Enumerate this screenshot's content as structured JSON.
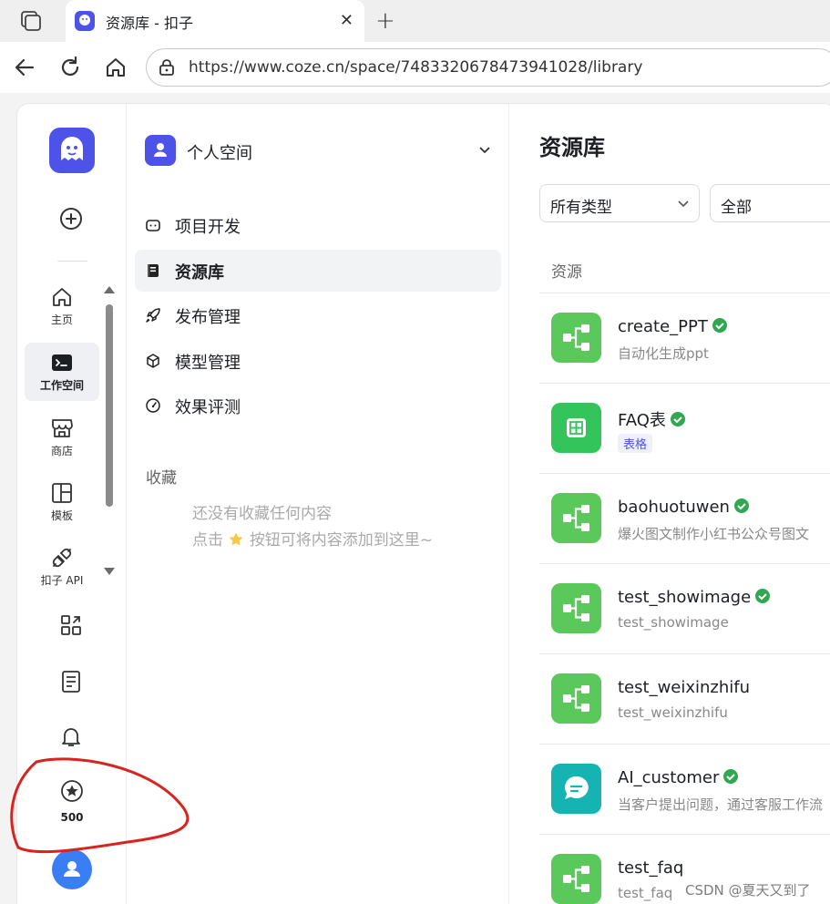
{
  "browser": {
    "tab_title": "资源库 - 扣子",
    "url": "https://www.coze.cn/space/7483320678473941028/library"
  },
  "rail": {
    "items": [
      {
        "label": "主页",
        "icon": "home-icon"
      },
      {
        "label": "工作空间",
        "icon": "workspace-icon"
      },
      {
        "label": "商店",
        "icon": "store-icon"
      },
      {
        "label": "模板",
        "icon": "template-icon"
      },
      {
        "label": "扣子 API",
        "icon": "api-icon"
      }
    ],
    "credits": "500"
  },
  "sidebar": {
    "space_name": "个人空间",
    "menu": [
      {
        "label": "项目开发",
        "icon": "robot-icon"
      },
      {
        "label": "资源库",
        "icon": "library-icon"
      },
      {
        "label": "发布管理",
        "icon": "rocket-icon"
      },
      {
        "label": "模型管理",
        "icon": "cube-icon"
      },
      {
        "label": "效果评测",
        "icon": "gauge-icon"
      }
    ],
    "favorites_heading": "收藏",
    "favorites_empty_line1": "还没有收藏任何内容",
    "favorites_empty_line2_prefix": "点击",
    "favorites_empty_line2_suffix": "按钮可将内容添加到这里~"
  },
  "main": {
    "title": "资源库",
    "filter_type": "所有类型",
    "filter_scope": "全部",
    "column_resource": "资源",
    "resources": [
      {
        "name": "create_PPT",
        "desc": "自动化生成ppt",
        "icon": "workflow-icon",
        "color": "#5ac85a"
      },
      {
        "name": "FAQ表",
        "tag": "表格",
        "icon": "table-icon",
        "color": "#34c45c"
      },
      {
        "name": "baohuotuwen",
        "desc": "爆火图文制作小红书公众号图文",
        "icon": "workflow-icon",
        "color": "#5ac85a"
      },
      {
        "name": "test_showimage",
        "desc": "test_showimage",
        "icon": "workflow-icon",
        "color": "#5ac85a"
      },
      {
        "name": "test_weixinzhifu",
        "desc": "test_weixinzhifu",
        "icon": "workflow-icon",
        "color": "#5ac85a"
      },
      {
        "name": "AI_customer",
        "desc": "当客户提出问题，通过客服工作流",
        "icon": "chat-icon",
        "color": "#16b3b3"
      },
      {
        "name": "test_faq",
        "desc": "test_faq",
        "icon": "workflow-icon",
        "color": "#5ac85a"
      }
    ]
  },
  "watermark": "CSDN @夏天又到了"
}
